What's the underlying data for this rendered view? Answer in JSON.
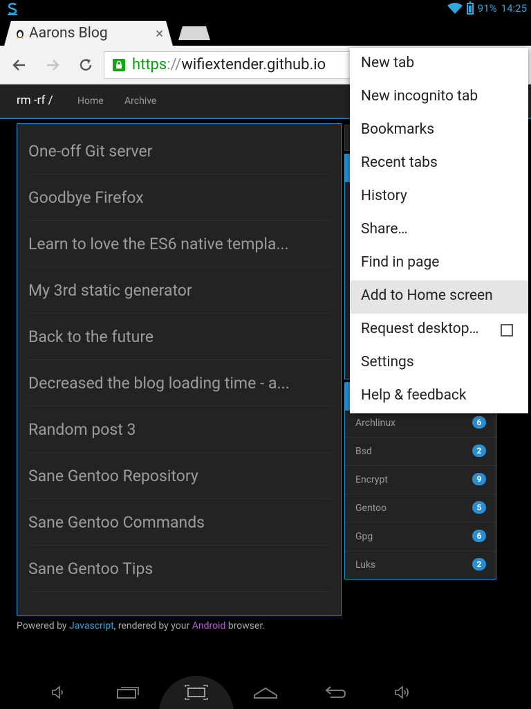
{
  "status_bar": {
    "battery": "91%",
    "time": "14:25",
    "icons": [
      "sync-logo-icon",
      "wifi-icon",
      "battery-icon"
    ]
  },
  "tab": {
    "title": "Aarons Blog",
    "close_glyph": "×"
  },
  "toolbar": {
    "url_scheme": "https",
    "url_sep": "://",
    "url_host": "wifiextender.github.io"
  },
  "site_nav": {
    "brand": "rm -rf /",
    "links": [
      "Home",
      "Archive"
    ]
  },
  "posts": [
    "One-off Git server",
    "Goodbye Firefox",
    "Learn to love the ES6 native templa...",
    "My 3rd static generator",
    "Back to the future",
    "Decreased the blog loading time - a...",
    "Random post 3",
    "Sane Gentoo Repository",
    "Sane Gentoo Commands",
    "Sane Gentoo Tips"
  ],
  "tags": [
    {
      "name": "Archlinux",
      "count": "6"
    },
    {
      "name": "Bsd",
      "count": "2"
    },
    {
      "name": "Encrypt",
      "count": "9"
    },
    {
      "name": "Gentoo",
      "count": "5"
    },
    {
      "name": "Gpg",
      "count": "6"
    },
    {
      "name": "Luks",
      "count": "2"
    }
  ],
  "footer": {
    "prefix": "Powered by ",
    "js": "Javascript",
    "middle": ", rendered by your ",
    "android": "Android",
    "suffix": " browser."
  },
  "menu": {
    "items": [
      "New tab",
      "New incognito tab",
      "Bookmarks",
      "Recent tabs",
      "History",
      "Share…",
      "Find in page",
      "Add to Home screen",
      "Request desktop…",
      "Settings",
      "Help & feedback"
    ],
    "highlighted": "Add to Home screen",
    "request_desktop_checked": false
  },
  "colors": {
    "accent": "#2a8fd0",
    "secure": "#0c9f0c",
    "link_purple": "#b45fd3"
  }
}
